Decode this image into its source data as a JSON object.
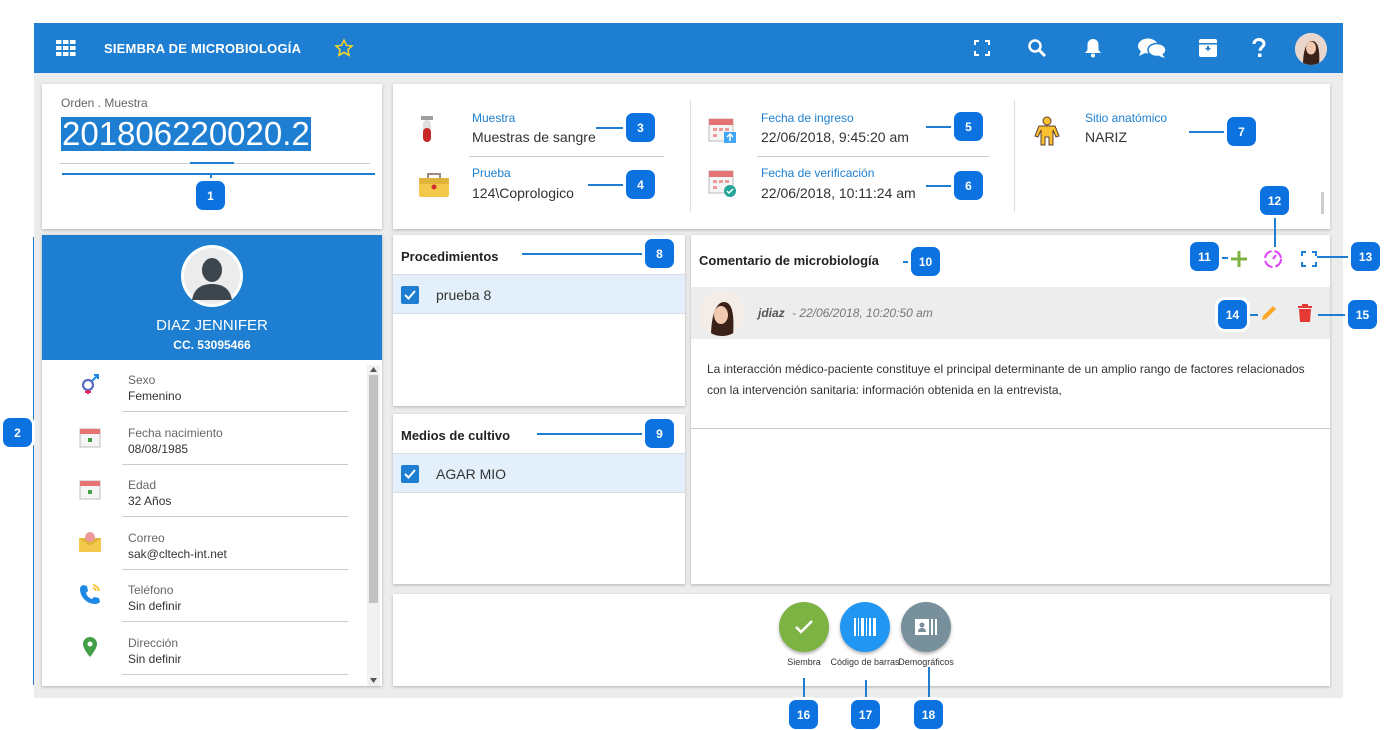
{
  "header": {
    "title": "SIEMBRA DE MICROBIOLOGÍA",
    "icons": [
      "apps-grid-icon",
      "star-icon",
      "fullscreen-icon",
      "search-icon",
      "bell-icon",
      "chat-icon",
      "archive-icon",
      "help-icon",
      "user-avatar"
    ]
  },
  "order": {
    "label": "Orden . Muestra",
    "value": "201806220020.2"
  },
  "sample_info": {
    "muestra_label": "Muestra",
    "muestra_value": "Muestras de sangre",
    "prueba_label": "Prueba",
    "prueba_value": "124\\Coprologico",
    "ingreso_label": "Fecha de ingreso",
    "ingreso_value": "22/06/2018, 9:45:20 am",
    "verif_label": "Fecha de verificación",
    "verif_value": "22/06/2018, 10:11:24 am",
    "sitio_label": "Sitio anatómico",
    "sitio_value": "NARIZ"
  },
  "patient": {
    "name": "DIAZ JENNIFER",
    "id": "CC. 53095466",
    "fields": [
      {
        "key": "Sexo",
        "value": "Femenino",
        "icon": "gender-icon"
      },
      {
        "key": "Fecha nacimiento",
        "value": "08/08/1985",
        "icon": "calendar-icon"
      },
      {
        "key": "Edad",
        "value": "32 Años",
        "icon": "calendar-icon"
      },
      {
        "key": "Correo",
        "value": "sak@cltech-int.net",
        "icon": "mail-icon"
      },
      {
        "key": "Teléfono",
        "value": "Sin definir",
        "icon": "phone-icon"
      },
      {
        "key": "Dirección",
        "value": "Sin definir",
        "icon": "location-icon"
      }
    ]
  },
  "procedimientos": {
    "title": "Procedimientos",
    "items": [
      "prueba 8"
    ]
  },
  "medios": {
    "title": "Medios de cultivo",
    "items": [
      "AGAR MIO"
    ]
  },
  "comentario": {
    "title": "Comentario de microbiología",
    "author": "jdiaz",
    "date": "- 22/06/2018, 10:20:50 am",
    "text": "La interacción médico-paciente constituye el principal determinante de un amplio rango de factores relacionados con la intervención sanitaria: información obtenida en la entrevista,"
  },
  "actions": {
    "siembra": "Siembra",
    "codigo": "Código de barras",
    "demograficos": "Demográficos"
  },
  "badges": [
    "1",
    "2",
    "3",
    "4",
    "5",
    "6",
    "7",
    "8",
    "9",
    "10",
    "11",
    "12",
    "13",
    "14",
    "15",
    "16",
    "17",
    "18"
  ],
  "colors": {
    "primary": "#1e7fd2",
    "badge": "#0b72e0",
    "green": "#7cb342",
    "grey_btn": "#78909c",
    "magenta": "#e040fb",
    "orange": "#f9a825",
    "red": "#e53935"
  }
}
